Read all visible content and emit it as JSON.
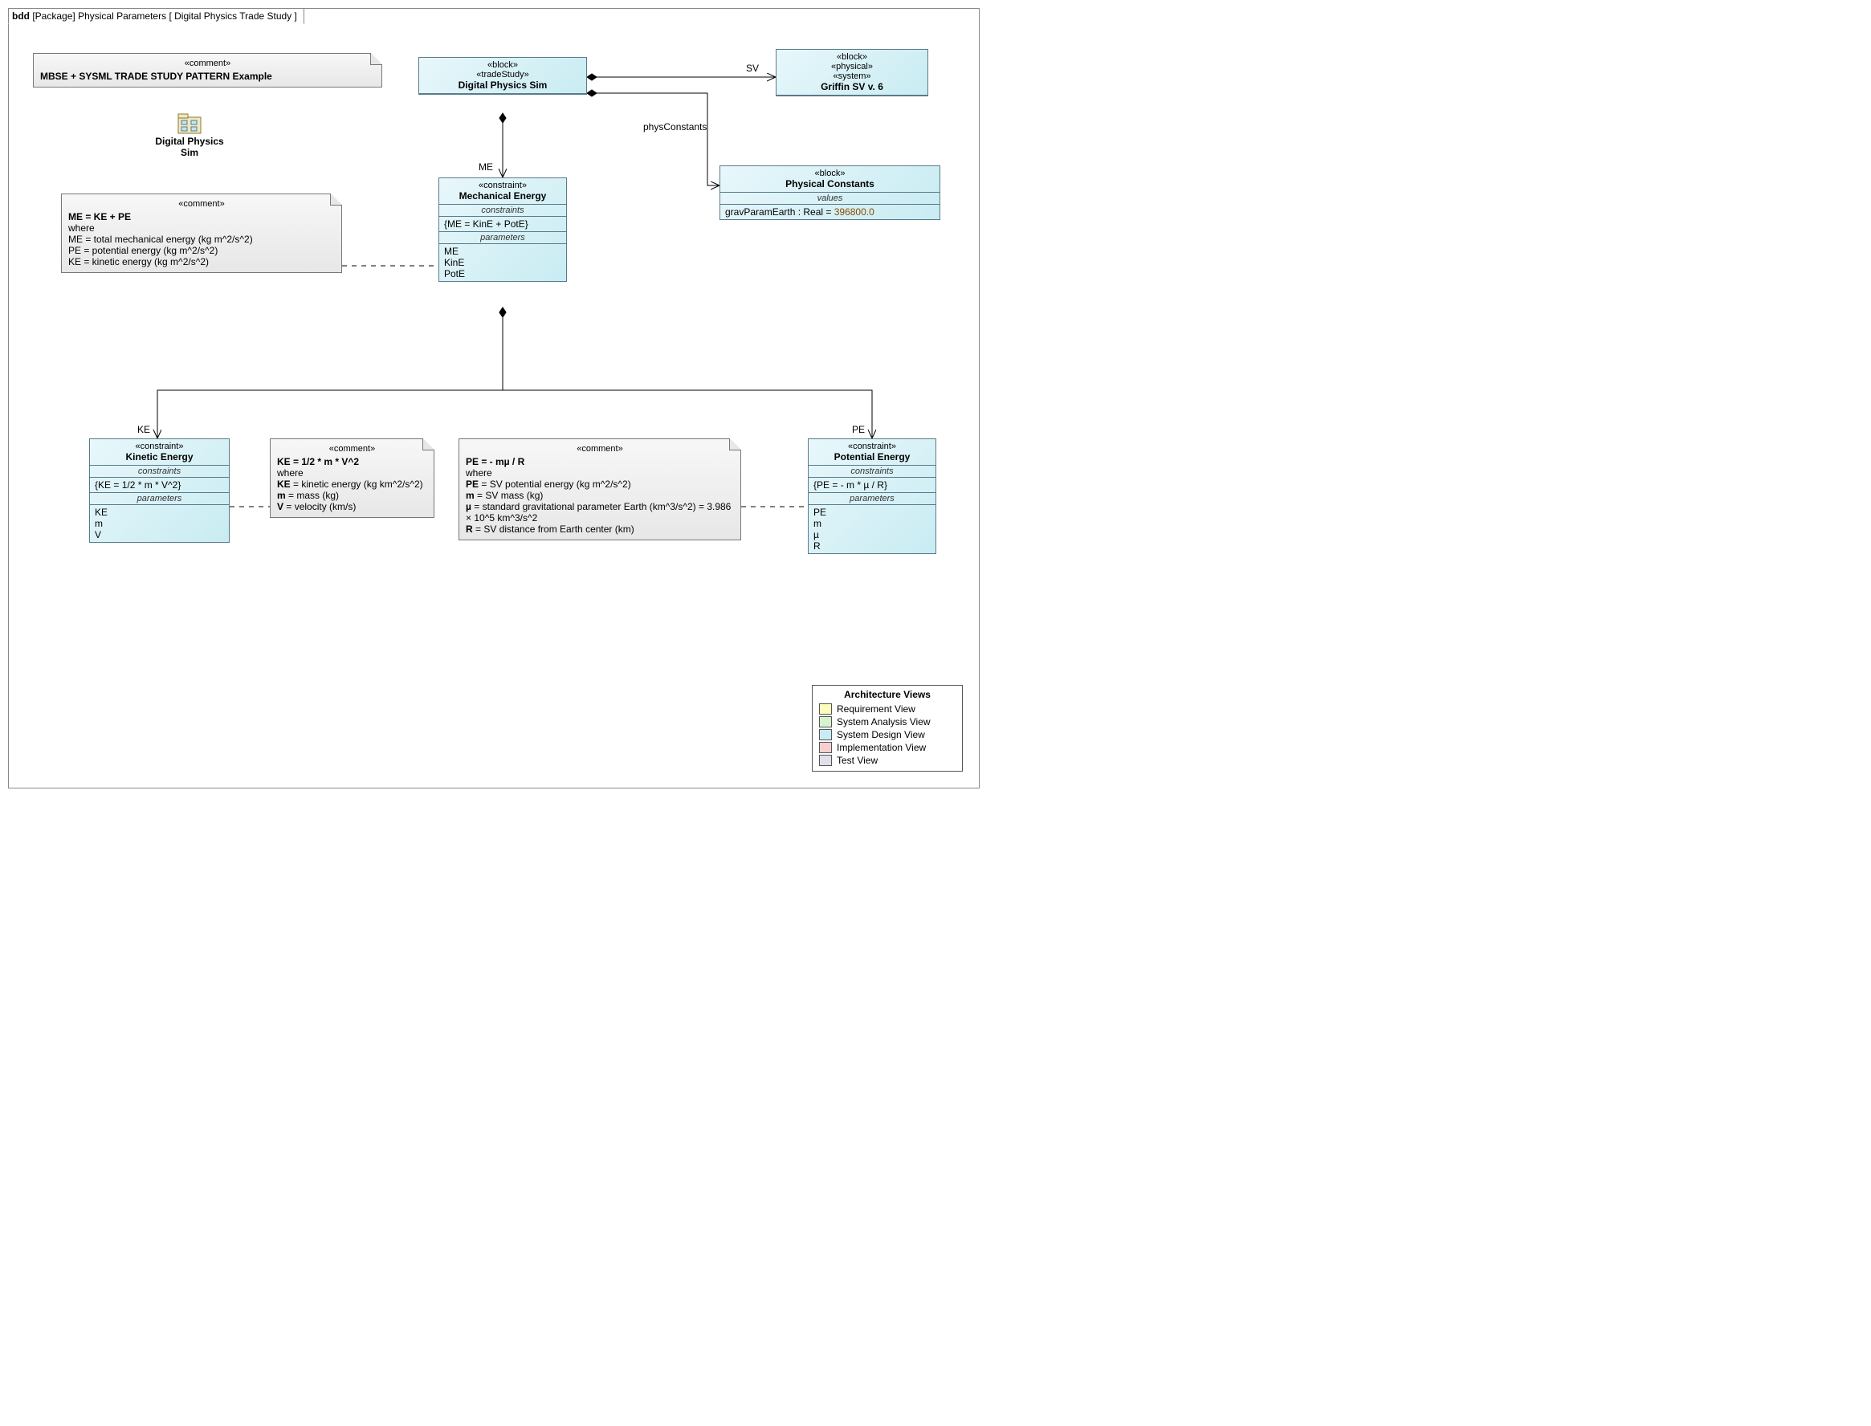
{
  "frame": {
    "kind": "bdd",
    "pkgLabel": "[Package]",
    "pkgName": "Physical Parameters",
    "diagramName": "[ Digital Physics Trade Study ]"
  },
  "titleComment": {
    "stereo": "«comment»",
    "text": "MBSE + SYSML TRADE STUDY PATTERN Example"
  },
  "pkgIconLabel": "Digital Physics\nSim",
  "blocks": {
    "sim": {
      "stereos": "«block»\n«tradeStudy»",
      "name": "Digital Physics Sim"
    },
    "griffin": {
      "stereos": "«block»\n«physical»\n«system»",
      "name": "Griffin SV v. 6"
    },
    "physConst": {
      "stereos": "«block»",
      "name": "Physical Constants",
      "valuesLabel": "values",
      "valueLine": "gravParamEarth : Real = ",
      "valueInit": "396800.0"
    },
    "me": {
      "stereos": "«constraint»",
      "name": "Mechanical Energy",
      "constraintsLabel": "constraints",
      "constraint": "{ME = KinE + PotE}",
      "paramsLabel": "parameters",
      "params": "ME\nKinE\nPotE"
    },
    "ke": {
      "stereos": "«constraint»",
      "name": "Kinetic Energy",
      "constraintsLabel": "constraints",
      "constraint": "{KE = 1/2 * m * V^2}",
      "paramsLabel": "parameters",
      "params": "KE\nm\nV"
    },
    "pe": {
      "stereos": "«constraint»",
      "name": "Potential Energy",
      "constraintsLabel": "constraints",
      "constraint": "{PE = - m * µ / R}",
      "paramsLabel": "parameters",
      "params": "PE\nm\nµ\nR"
    }
  },
  "notes": {
    "me": {
      "stereo": "«comment»",
      "lines": [
        {
          "b": "ME = KE + PE"
        },
        {
          "t": "where"
        },
        {
          "t": "ME = total mechanical energy (kg m^2/s^2)"
        },
        {
          "t": "PE = potential energy (kg m^2/s^2)"
        },
        {
          "t": "KE = kinetic energy (kg m^2/s^2)"
        }
      ]
    },
    "ke": {
      "stereo": "«comment»",
      "lines": [
        {
          "b": "KE = 1/2 * m * V^2"
        },
        {
          "t": "where"
        },
        {
          "span": [
            {
              "b": "KE"
            },
            {
              "t": " = kinetic energy (kg km^2/s^2)"
            }
          ]
        },
        {
          "span": [
            {
              "b": "m"
            },
            {
              "t": " = mass (kg)"
            }
          ]
        },
        {
          "span": [
            {
              "b": "V"
            },
            {
              "t": " = velocity (km/s)"
            }
          ]
        }
      ]
    },
    "pe": {
      "stereo": "«comment»",
      "lines": [
        {
          "b": "PE = - mµ / R"
        },
        {
          "t": "where"
        },
        {
          "span": [
            {
              "b": "PE"
            },
            {
              "t": " = SV potential energy (kg m^2/s^2)"
            }
          ]
        },
        {
          "span": [
            {
              "b": "m"
            },
            {
              "t": " = SV mass (kg)"
            }
          ]
        },
        {
          "span": [
            {
              "b": "µ"
            },
            {
              "t": " = standard gravitational parameter Earth (km^3/s^2) = 3.986 × 10^5 km^3/s^2"
            }
          ]
        },
        {
          "span": [
            {
              "b": "R"
            },
            {
              "t": " = SV distance from Earth center (km)"
            }
          ]
        }
      ]
    }
  },
  "roleLabels": {
    "sv": "SV",
    "physConstants": "physConstants",
    "me": "ME",
    "ke": "KE",
    "pe": "PE"
  },
  "legend": {
    "title": "Architecture Views",
    "rows": [
      {
        "color": "#fdfcbf",
        "label": "Requirement View"
      },
      {
        "color": "#d6f3d0",
        "label": "System Analysis View"
      },
      {
        "color": "#c8ecf2",
        "label": "System Design View"
      },
      {
        "color": "#f6cfcf",
        "label": "Implementation View"
      },
      {
        "color": "#e0e0ec",
        "label": "Test View"
      }
    ]
  }
}
